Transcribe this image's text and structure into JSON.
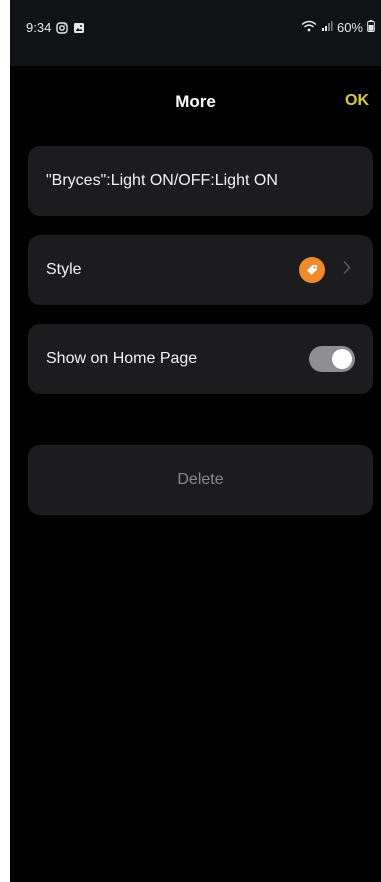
{
  "status_bar": {
    "time": "9:34",
    "battery": "60%",
    "icons": [
      "instagram-icon",
      "image-icon",
      "wifi-icon",
      "signal-icon",
      "battery-icon"
    ]
  },
  "header": {
    "title": "More",
    "ok_label": "OK"
  },
  "items": {
    "name": "\"Bryces\":Light ON/OFF:Light ON",
    "style_label": "Style",
    "style_icon": "tag-icon",
    "show_home_label": "Show on Home Page",
    "show_home_enabled": true,
    "delete_label": "Delete"
  },
  "colors": {
    "accent": "#d6c93a",
    "badge": "#f08a2b",
    "card": "#1c1c1e",
    "background": "#000000"
  }
}
